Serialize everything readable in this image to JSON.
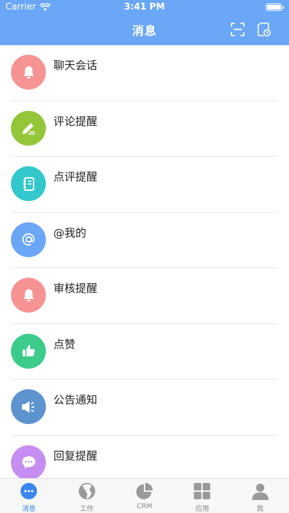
{
  "status_bar": {
    "carrier": "Carrier",
    "time": "3:41 PM"
  },
  "header": {
    "title": "消息"
  },
  "messages": [
    {
      "label": "聊天会话",
      "icon": "bell-icon",
      "color": "#f69493"
    },
    {
      "label": "评论提醒",
      "icon": "pencil-icon",
      "color": "#94c63a"
    },
    {
      "label": "点评提醒",
      "icon": "notebook-icon",
      "color": "#33c8cc"
    },
    {
      "label": "@我的",
      "icon": "at-icon",
      "color": "#6ba6f7"
    },
    {
      "label": "审核提醒",
      "icon": "bell-icon",
      "color": "#f69493"
    },
    {
      "label": "点赞",
      "icon": "thumbs-up-icon",
      "color": "#3dcb8c"
    },
    {
      "label": "公告通知",
      "icon": "megaphone-icon",
      "color": "#5d93cf"
    },
    {
      "label": "回复提醒",
      "icon": "chat-bubble-icon",
      "color": "#c58ef0"
    }
  ],
  "tabs": [
    {
      "label": "消息",
      "icon": "message-dots-icon",
      "active": true
    },
    {
      "label": "工作",
      "icon": "globe-icon",
      "active": false
    },
    {
      "label": "CRM",
      "icon": "pie-chart-icon",
      "active": false
    },
    {
      "label": "应用",
      "icon": "apps-grid-icon",
      "active": false
    },
    {
      "label": "我",
      "icon": "person-icon",
      "active": false
    }
  ],
  "colors": {
    "header": "#6aa7f7",
    "tab_active": "#3a86f0",
    "tab_inactive": "#9a9a9a"
  }
}
